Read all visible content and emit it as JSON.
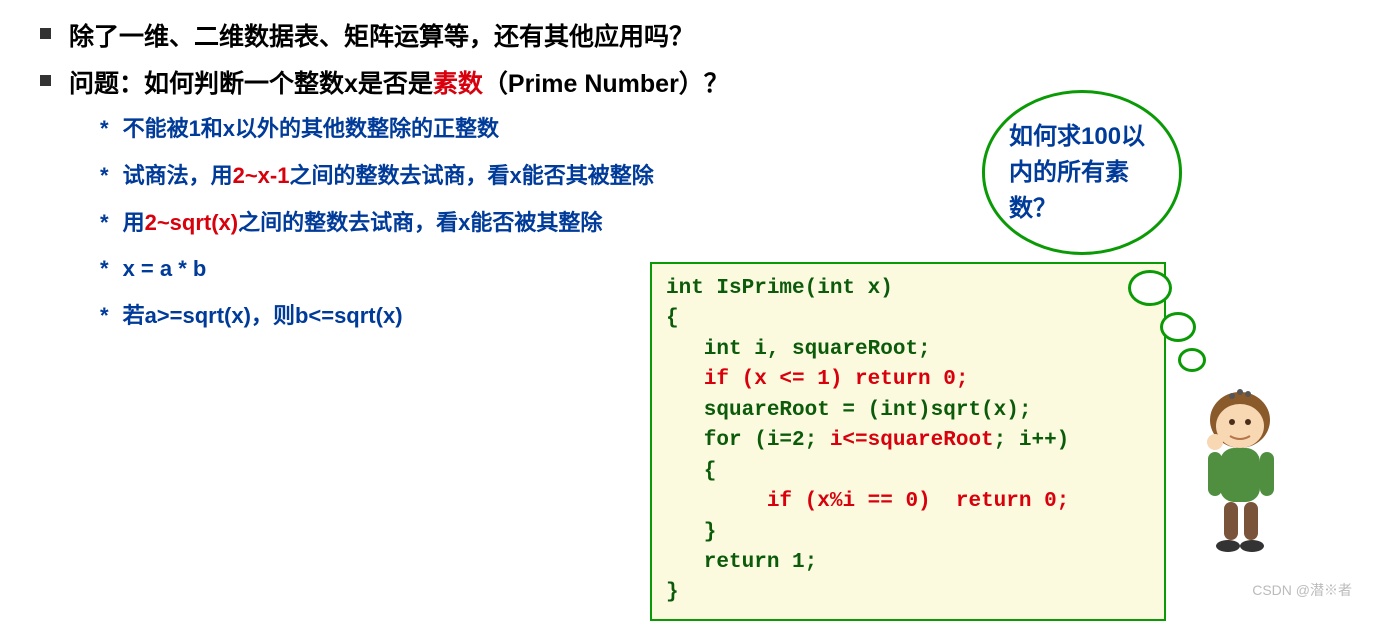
{
  "bullets": {
    "b1": "除了一维、二维数据表、矩阵运算等，还有其他应用吗？",
    "b2_pre": "问题：如何判断一个整数x是否是",
    "b2_red": "素数",
    "b2_post": "（Prime Number）？"
  },
  "sub": {
    "s1": "不能被1和x以外的其他数整除的正整数",
    "s2_a": "试商法，用",
    "s2_red": "2~x-1",
    "s2_b": "之间的整数去试商，看x能否其被整除",
    "s3_a": "用",
    "s3_red": "2~sqrt(x)",
    "s3_b": "之间的整数去试商，看x能否被其整除",
    "s4": "x = a * b",
    "s5": "若a>=sqrt(x)，则b<=sqrt(x)"
  },
  "code": {
    "l1": "int IsPrime(int x)",
    "l2": "{",
    "l3": "   int i, squareRoot;",
    "l4a": "   ",
    "l4r": "if (x <= 1) return 0;",
    "l5": "   squareRoot = (int)sqrt(x);",
    "l6a": "   for (i=2; ",
    "l6r": "i<=squareRoot",
    "l6b": "; i++)",
    "l7": "   {",
    "l8a": "        ",
    "l8r": "if (x%i == 0)  return 0;",
    "l9": "   }",
    "l10": "   return 1;",
    "l11": "}"
  },
  "thought": "如何求100以内的所有素数？",
  "watermark": "CSDN @潜※者"
}
